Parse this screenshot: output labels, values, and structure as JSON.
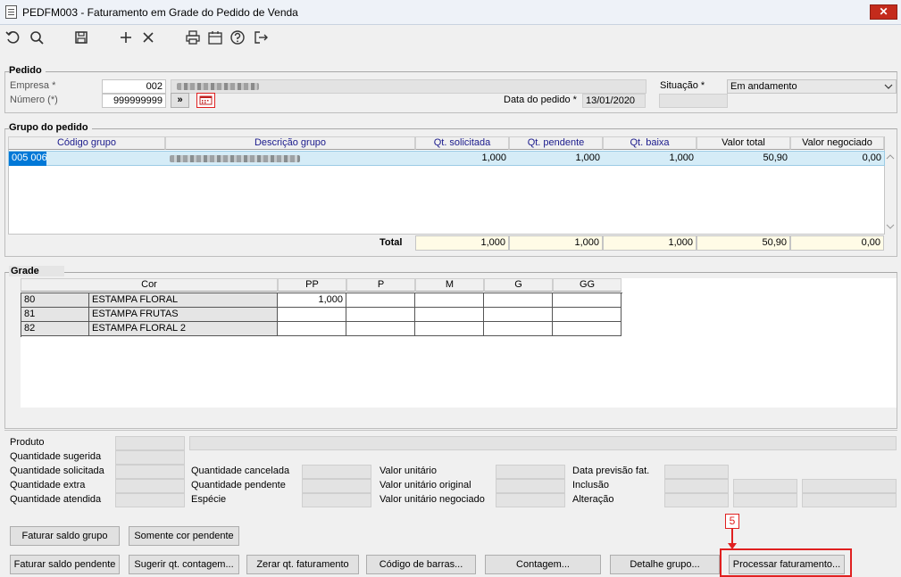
{
  "window": {
    "title": "PEDFM003 - Faturamento em Grade do Pedido de Venda",
    "close_label": "✕"
  },
  "toolbar": {
    "icons": [
      "undo-icon",
      "search-icon",
      "save-icon",
      "add-icon",
      "delete-icon",
      "print-icon",
      "calendar-icon",
      "help-icon",
      "exit-icon"
    ]
  },
  "pedido": {
    "group_label": "Pedido",
    "empresa_label": "Empresa *",
    "empresa_value": "002",
    "numero_label": "Número (*)",
    "numero_value": "999999999",
    "nav_label": "»",
    "situacao_label": "Situação *",
    "situacao_value": "Em andamento",
    "data_label": "Data do pedido *",
    "data_value": "13/01/2020"
  },
  "grupo": {
    "group_label": "Grupo do pedido",
    "columns": [
      "Código grupo",
      "Descrição grupo",
      "Qt. solicitada",
      "Qt. pendente",
      "Qt. baixa",
      "Valor total",
      "Valor  negociado"
    ],
    "rows": [
      {
        "codigo": "005 006",
        "qt_solicitada": "1,000",
        "qt_pendente": "1,000",
        "qt_baixa": "1,000",
        "valor_total": "50,90",
        "valor_negociado": "0,00"
      }
    ],
    "total_label": "Total",
    "totals": {
      "qt_solicitada": "1,000",
      "qt_pendente": "1,000",
      "qt_baixa": "1,000",
      "valor_total": "50,90",
      "valor_negociado": "0,00"
    }
  },
  "grade": {
    "group_label": "Grade",
    "cor_header": "Cor",
    "sizes": [
      "PP",
      "P",
      "M",
      "G",
      "GG"
    ],
    "rows": [
      {
        "code": "80",
        "name": "ESTAMPA FLORAL",
        "values": [
          "1,000",
          "",
          "",
          "",
          ""
        ]
      },
      {
        "code": "81",
        "name": "ESTAMPA FRUTAS",
        "values": [
          "",
          "",
          "",
          "",
          ""
        ]
      },
      {
        "code": "82",
        "name": "ESTAMPA FLORAL 2",
        "values": [
          "",
          "",
          "",
          "",
          ""
        ]
      }
    ]
  },
  "details": {
    "produto": "Produto",
    "qtd_sugerida": "Quantidade sugerida",
    "qtd_solicitada": "Quantidade solicitada",
    "qtd_extra": "Quantidade extra",
    "qtd_atendida": "Quantidade atendida",
    "qtd_cancelada": "Quantidade cancelada",
    "qtd_pendente": "Quantidade pendente",
    "especie": "Espécie",
    "valor_unitario": "Valor unitário",
    "valor_unitario_original": "Valor unitário original",
    "valor_unitario_negociado": "Valor unitário negociado",
    "data_previsao": "Data previsão fat.",
    "inclusao": "Inclusão",
    "alteracao": "Alteração"
  },
  "buttons": {
    "faturar_saldo_grupo": "Faturar saldo grupo",
    "somente_cor_pendente": "Somente cor pendente",
    "faturar_saldo_pendente": "Faturar saldo pendente",
    "sugerir_qt_contagem": "Sugerir qt. contagem...",
    "zerar_qt_faturamento": "Zerar qt. faturamento",
    "codigo_barras": "Código de barras...",
    "contagem": "Contagem...",
    "detalhe_grupo": "Detalhe grupo...",
    "processar_faturamento": "Processar faturamento..."
  },
  "annotation": {
    "step": "5",
    "color": "#e02020"
  }
}
